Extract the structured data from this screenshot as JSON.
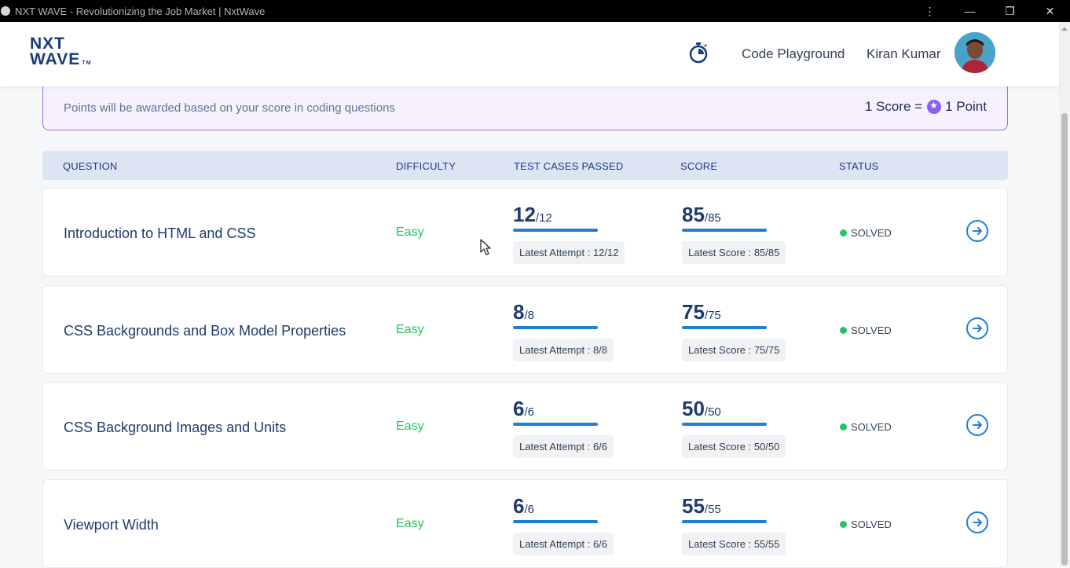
{
  "window": {
    "title": "NXT WAVE - Revolutionizing the Job Market | NxtWave"
  },
  "header": {
    "logo_line1": "NXT",
    "logo_line2": "WAVE",
    "logo_tm": "TM",
    "code_playground": "Code Playground",
    "user_name": "Kiran Kumar"
  },
  "banner": {
    "message": "Points will be awarded based on your score in coding questions",
    "points_prefix": "1 Score =",
    "points_suffix": "1 Point"
  },
  "table": {
    "headers": {
      "question": "QUESTION",
      "difficulty": "DIFFICULTY",
      "test_cases": "TEST CASES PASSED",
      "score": "SCORE",
      "status": "STATUS"
    },
    "rows": [
      {
        "title": "Introduction to HTML and CSS",
        "difficulty": "Easy",
        "tc_passed": "12",
        "tc_total": "/12",
        "tc_latest": "Latest Attempt : 12/12",
        "tc_progress": 1.0,
        "score": "85",
        "score_total": "/85",
        "score_latest": "Latest Score : 85/85",
        "score_progress": 1.0,
        "status": "SOLVED"
      },
      {
        "title": "CSS Backgrounds and Box Model Properties",
        "difficulty": "Easy",
        "tc_passed": "8",
        "tc_total": "/8",
        "tc_latest": "Latest Attempt : 8/8",
        "tc_progress": 1.0,
        "score": "75",
        "score_total": "/75",
        "score_latest": "Latest Score : 75/75",
        "score_progress": 1.0,
        "status": "SOLVED"
      },
      {
        "title": "CSS Background Images and Units",
        "difficulty": "Easy",
        "tc_passed": "6",
        "tc_total": "/6",
        "tc_latest": "Latest Attempt : 6/6",
        "tc_progress": 1.0,
        "score": "50",
        "score_total": "/50",
        "score_latest": "Latest Score : 50/50",
        "score_progress": 1.0,
        "status": "SOLVED"
      },
      {
        "title": "Viewport Width",
        "difficulty": "Easy",
        "tc_passed": "6",
        "tc_total": "/6",
        "tc_latest": "Latest Attempt : 6/6",
        "tc_progress": 1.0,
        "score": "55",
        "score_total": "/55",
        "score_latest": "Latest Score : 55/55",
        "score_progress": 1.0,
        "status": "SOLVED"
      }
    ]
  },
  "colors": {
    "brand": "#183b7c",
    "accent": "#1f7fd6",
    "easy": "#22c55e",
    "solved_dot": "#22c55e",
    "banner_border": "#9b6fe0"
  },
  "icons": {
    "timer": "stopwatch-icon",
    "coin": "star-coin-icon",
    "go": "arrow-right-circle-icon",
    "status": "green-dot"
  }
}
